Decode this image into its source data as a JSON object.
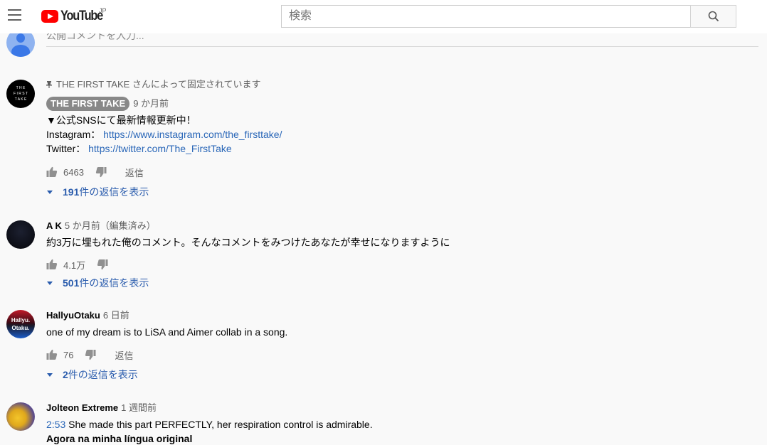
{
  "header": {
    "logo_text": "YouTube",
    "logo_region": "JP",
    "search_placeholder": "検索"
  },
  "comment_input": {
    "placeholder": "公開コメントを入力..."
  },
  "comments": [
    {
      "pinned_label": "THE FIRST TAKE さんによって固定されています",
      "author": "THE FIRST TAKE",
      "author_is_badge": true,
      "time": "9 か月前",
      "lines": [
        {
          "prefix": "▼公式SNSにて最新情報更新中！",
          "link": ""
        },
        {
          "prefix": "Instagram： ",
          "link": "https://www.instagram.com/the_firsttake/"
        },
        {
          "prefix": "Twitter： ",
          "link": "https://twitter.com/The_FirstTake"
        }
      ],
      "likes": "6463",
      "reply_label": "返信",
      "replies_count": "191",
      "replies_suffix": " 件の返信を表示",
      "avatar_text": [
        "T H E",
        "F I R S T",
        "T A K E"
      ]
    },
    {
      "author": "A K",
      "time": "5 か月前（編集済み）",
      "text": "約3万に埋もれた俺のコメント。そんなコメントをみつけたあなたが幸せになりますように",
      "likes": "4.1万",
      "replies_count": "501",
      "replies_suffix": " 件の返信を表示"
    },
    {
      "author": "HallyuOtaku",
      "time": "6 日前",
      "text": "one of my dream is to LiSA and Aimer collab in a song.",
      "likes": "76",
      "reply_label": "返信",
      "replies_count": "2",
      "replies_suffix": " 件の返信を表示",
      "avatar_text": [
        "Hallyu.",
        "Otaku."
      ]
    },
    {
      "author": "Jolteon Extreme",
      "time": "1 週間前",
      "timestamp_link": "2:53",
      "text": " She made this part PERFECTLY, her respiration control is admirable.",
      "translation_label": "Agora na minha língua original"
    }
  ],
  "colors": {
    "youtube_red": "#ff0000",
    "link_blue": "#2a67b8",
    "badge_gray": "#888888",
    "background": "#f9f9f9"
  }
}
